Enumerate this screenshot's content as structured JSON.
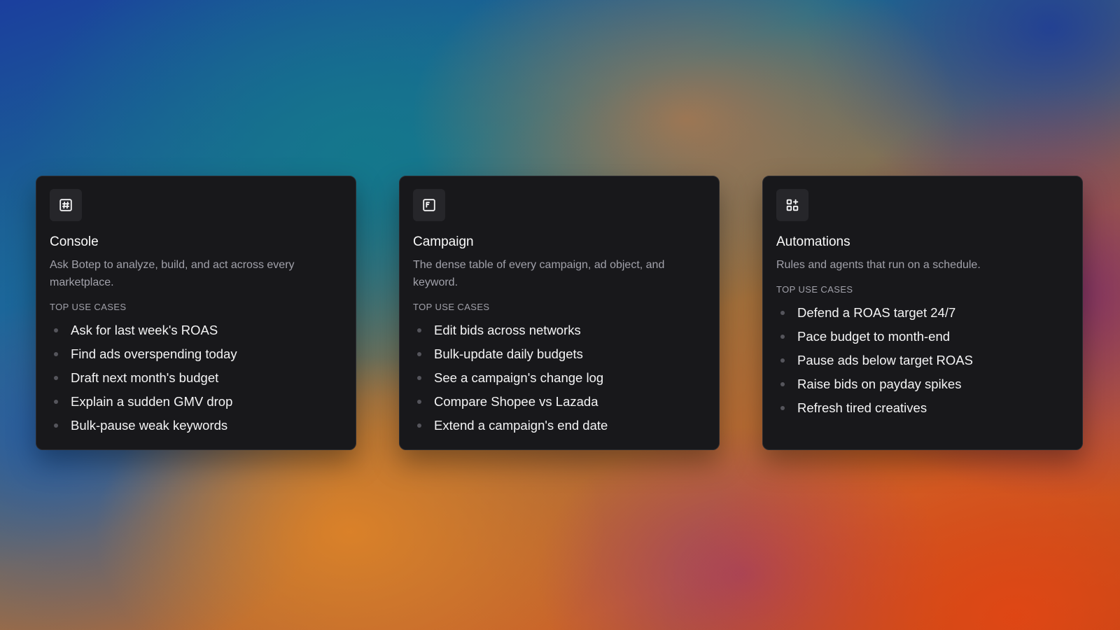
{
  "cards": [
    {
      "icon": "hash-square-icon",
      "title": "Console",
      "description": "Ask Botep to analyze, build, and act across every marketplace.",
      "section_label": "TOP USE CASES",
      "items": [
        "Ask for last week's ROAS",
        "Find ads overspending today",
        "Draft next month's budget",
        "Explain a sudden GMV drop",
        "Bulk-pause weak keywords"
      ]
    },
    {
      "icon": "table-list-icon",
      "title": "Campaign",
      "description": "The dense table of every campaign, ad object, and keyword.",
      "section_label": "TOP USE CASES",
      "items": [
        "Edit bids across networks",
        "Bulk-update daily budgets",
        "See a campaign's change log",
        "Compare Shopee vs Lazada",
        "Extend a campaign's end date"
      ]
    },
    {
      "icon": "grid-plus-icon",
      "title": "Automations",
      "description": "Rules and agents that run on a schedule.",
      "section_label": "TOP USE CASES",
      "items": [
        "Defend a ROAS target 24/7",
        "Pace budget to month-end",
        "Pause ads below target ROAS",
        "Raise bids on payday spikes",
        "Refresh tired creatives"
      ]
    }
  ]
}
